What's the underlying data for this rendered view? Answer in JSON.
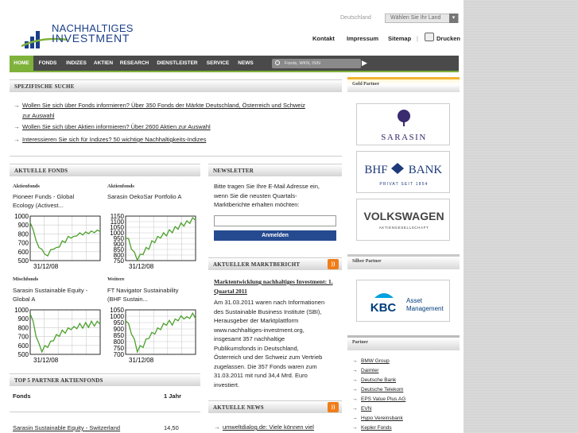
{
  "brand": {
    "line1": "NACHHALTIGES",
    "line2": "INVESTMENT",
    "color": "#1a3f8a",
    "accent": "#7fb23b"
  },
  "country": {
    "label": "Deutschland",
    "select_value": "Wählen Sie Ihr Land"
  },
  "toplinks": {
    "kontakt": "Kontakt",
    "impressum": "Impressum",
    "sitemap": "Sitemap",
    "separator": "|",
    "drucken": "Drucken"
  },
  "nav": {
    "items": [
      "HOME",
      "FONDS",
      "INDIZES",
      "AKTIEN",
      "RESEARCH",
      "DIENSTLEISTER",
      "SERVICE",
      "NEWS"
    ],
    "search_placeholder": "Fonds, WKN, ISIN",
    "go": "▶"
  },
  "search_section": {
    "title": "SPEZIFISCHE SUCHE",
    "links": [
      "Wollen Sie sich über Fonds informieren? Über 350 Fonds der Märkte Deutschland, Österreich und Schweiz",
      "zur Auswahl",
      "Wollen Sie sich über Aktien informieren? Über 2600 Aktien zur Auswahl",
      "Interessieren Sie sich für Indizes? 50 wichtige Nachhaltigkeits-Indizes"
    ]
  },
  "funds": {
    "title": "AKTUELLE FONDS",
    "items": [
      {
        "category": "Aktienfonds",
        "name1": "Pioneer Funds - Global",
        "name2": "Ecology (Activest...",
        "yticks": [
          "1000",
          "900",
          "800",
          "700",
          "600",
          "500"
        ],
        "xlabel": "31/12/08"
      },
      {
        "category": "Aktienfonds",
        "name1": "Sarasin OekoSar Portfolio A",
        "name2": "",
        "yticks": [
          "1150",
          "1100",
          "1050",
          "1000",
          "950",
          "900",
          "850",
          "800",
          "750"
        ],
        "xlabel": "31/12/08"
      },
      {
        "category": "Mischfonds",
        "name1": "Sarasin Sustainable Equity -",
        "name2": "Global A",
        "yticks": [
          "1000",
          "900",
          "800",
          "700",
          "600",
          "500"
        ],
        "xlabel": "31/12/08"
      },
      {
        "category": "Weitere",
        "name1": "FT Navigator Sustainability",
        "name2": "(BHF Sustain...",
        "yticks": [
          "1050",
          "1000",
          "950",
          "900",
          "850",
          "800",
          "750",
          "700"
        ],
        "xlabel": "31/12/08"
      }
    ]
  },
  "top5": {
    "title": "TOP 5 PARTNER AKTIENFONDS",
    "col_fonds": "Fonds",
    "col_year": "1 Jahr",
    "rows": [
      {
        "name": "Sarasin Sustainable Equity - Switzerland",
        "value": "14,50"
      }
    ]
  },
  "newsletter": {
    "title": "NEWSLETTER",
    "text": [
      "Bitte tragen Sie Ihre E-Mail Adresse ein,",
      "wenn Sie die neusten Quartals-",
      "Marktberichte erhalten möchten:"
    ],
    "button": "Anmelden"
  },
  "market_report": {
    "title": "AKTUELLER MARKTBERICHT",
    "headline": [
      "Marktentwicklung nachhaltiges Investment: 1.",
      "Quartal 2011"
    ],
    "body": [
      "Am 31.03.2011 waren nach Informationen",
      "des Sustainable Business Institute (SBI),",
      "Herausgeber der Marktplattform",
      "www.nachhaltiges-investment.org,",
      "insgesamt 357 nachhaltige",
      "Publikumsfonds in Deutschland,",
      "Österreich und der Schweiz zum Vertrieb",
      "zugelassen. Die 357 Fonds waren zum",
      "31.03.2011 mit rund 34,4 Mrd. Euro",
      "investiert."
    ]
  },
  "news": {
    "title": "AKTUELLE NEWS",
    "first": "umweltdialog.de: Viele können viel"
  },
  "sidebar": {
    "gold_title": "Gold Partner",
    "silver_title": "Silber Partner",
    "partner_title": "Partner",
    "logos": {
      "sarasin": "SARASIN",
      "bhf1": "BHF",
      "bhf2": "BANK",
      "bhf_sub": "PRIVAT SEIT 1854",
      "vw": "VOLKSWAGEN",
      "vw_sub": "AKTIENGESELLSCHAFT",
      "kbc": "KBC",
      "kbc_sub1": "Asset",
      "kbc_sub2": "Management"
    },
    "partners": [
      "BMW Group",
      "Daimler",
      "Deutsche Bank",
      "Deutsche Telekom",
      "EPS Value Plus AG",
      "EVN",
      "Hypo Vereinsbank",
      "Kepler Fonds"
    ]
  }
}
